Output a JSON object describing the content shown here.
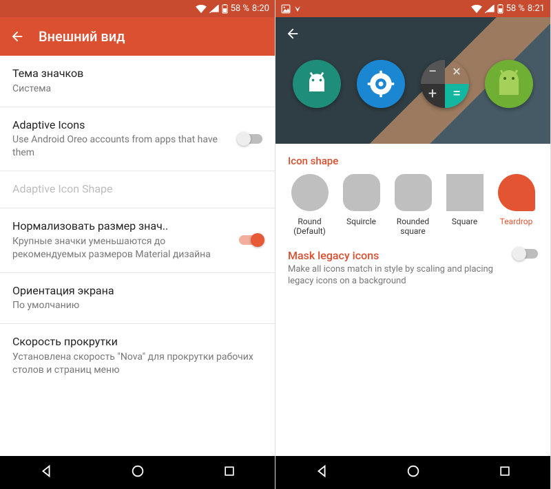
{
  "left": {
    "status": {
      "battery": "58 %",
      "time": "8:20"
    },
    "title": "Внешний вид",
    "rows": {
      "iconTheme": {
        "title": "Тема значков",
        "sub": "Система"
      },
      "adaptive": {
        "title": "Adaptive Icons",
        "sub": "Use Android Oreo accounts from apps that have them"
      },
      "adaptiveShape": {
        "title": "Adaptive Icon Shape"
      },
      "normalize": {
        "title": "Нормализовать размер знач..",
        "sub": "Крупные значки уменьшаются до рекомендуемых размеров Material дизайна"
      },
      "orientation": {
        "title": "Ориентация экрана",
        "sub": "По умолчанию"
      },
      "scroll": {
        "title": "Скорость прокрутки",
        "sub": "Установлена скорость \"Nova\" для прокрутки рабочих столов и страниц меню"
      }
    }
  },
  "right": {
    "status": {
      "battery": "58 %",
      "time": "8:21"
    },
    "section_shape": "Icon shape",
    "shapes": {
      "round": "Round\n(Default)",
      "squircle": "Squircle",
      "rsq": "Rounded\nsquare",
      "square": "Square",
      "teardrop": "Teardrop"
    },
    "mask": {
      "title": "Mask legacy icons",
      "sub": "Make all icons match in style by scaling and placing legacy icons on a background"
    }
  }
}
